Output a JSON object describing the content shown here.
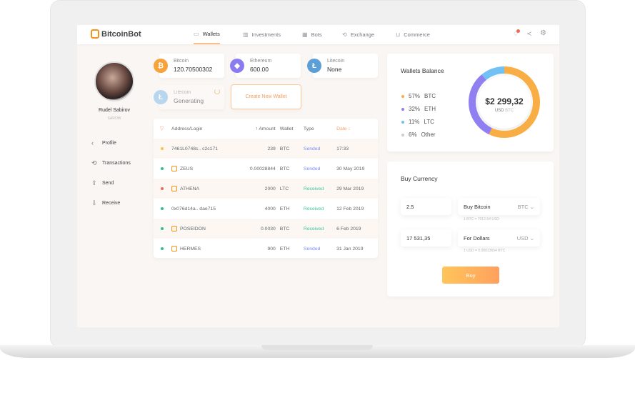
{
  "app": {
    "name": "BitcoinBot"
  },
  "nav": [
    {
      "label": "Wallets",
      "icon": "wallet-icon"
    },
    {
      "label": "Investments",
      "icon": "bar-chart-icon"
    },
    {
      "label": "Bots",
      "icon": "bot-icon"
    },
    {
      "label": "Exchange",
      "icon": "exchange-icon"
    },
    {
      "label": "Commerce",
      "icon": "cart-icon"
    }
  ],
  "header_icons": [
    "bell-icon",
    "share-icon",
    "gear-icon"
  ],
  "user": {
    "name": "Rudel Sabirov",
    "tag": "SAROW"
  },
  "sidebar": [
    {
      "label": "Profile",
      "icon": "chevron-left-icon"
    },
    {
      "label": "Transactions",
      "icon": "history-icon"
    },
    {
      "label": "Send",
      "icon": "upload-icon"
    },
    {
      "label": "Receive",
      "icon": "download-icon"
    }
  ],
  "wallets": [
    {
      "name": "Bitcoin",
      "value": "120.70500302",
      "color": "#f7a23b",
      "glyph": "₿"
    },
    {
      "name": "Ethereum",
      "value": "600.00",
      "color": "#8a7cf0",
      "glyph": "◆"
    },
    {
      "name": "Litecoin",
      "value": "None",
      "color": "#5b9fd6",
      "glyph": "Ł"
    },
    {
      "name": "Litecoin",
      "value": "Generating",
      "color": "#b9d6ef",
      "glyph": "Ł"
    }
  ],
  "create_wallet": "Create New Wallet",
  "table": {
    "headers": [
      "Address/Login",
      "↑ Amount",
      "Wallet",
      "Type",
      "Date ↓"
    ],
    "rows": [
      {
        "status": "#f7c44a",
        "logo": false,
        "address": "7461L0748c.. c2c171",
        "amount": "239",
        "wallet": "BTC",
        "type": "Sended",
        "date": "17:33"
      },
      {
        "status": "#2fbf8f",
        "logo": true,
        "address": "ZEUS",
        "amount": "0.00028844",
        "wallet": "BTC",
        "type": "Sended",
        "date": "30 May 2019"
      },
      {
        "status": "#f06a55",
        "logo": true,
        "address": "ATHENA",
        "amount": "2000",
        "wallet": "LTC",
        "type": "Received",
        "date": "29 Mar 2019"
      },
      {
        "status": "#2fbf8f",
        "logo": false,
        "address": "0x076d14a.. dae715",
        "amount": "4000",
        "wallet": "ETH",
        "type": "Received",
        "date": "12 Feb 2019"
      },
      {
        "status": "#2fbf8f",
        "logo": true,
        "address": "POSEIDON",
        "amount": "0.0030",
        "wallet": "BTC",
        "type": "Received",
        "date": "6 Feb 2019"
      },
      {
        "status": "#2fbf8f",
        "logo": true,
        "address": "HERMES",
        "amount": "900",
        "wallet": "ETH",
        "type": "Sended",
        "date": "31 Jan 2019"
      }
    ]
  },
  "balance": {
    "title": "Wallets Balance",
    "total": "$2 299,32",
    "unit1": "USD",
    "unit2": "BTC",
    "legend": [
      {
        "pct": "57%",
        "label": "BTC",
        "value": 57,
        "color": "#f9ad45"
      },
      {
        "pct": "32%",
        "label": "ETH",
        "value": 32,
        "color": "#8f7ff0"
      },
      {
        "pct": "11%",
        "label": "LTC",
        "value": 11,
        "color": "#72c1f5"
      },
      {
        "pct": "6%",
        "label": "Other",
        "value": 6,
        "color": "#cccccc"
      }
    ]
  },
  "buy": {
    "title": "Buy Currency",
    "amount": "2.5",
    "buy_label": "Buy Bitcoin",
    "buy_cur": "BTC",
    "rate1": "1 BTC = 7012.54 USD",
    "usd_amount": "17 531,35",
    "for_label": "For Dollars",
    "for_cur": "USD",
    "rate2": "1 USD = 0.00013654 BTC",
    "button": "Buy"
  }
}
